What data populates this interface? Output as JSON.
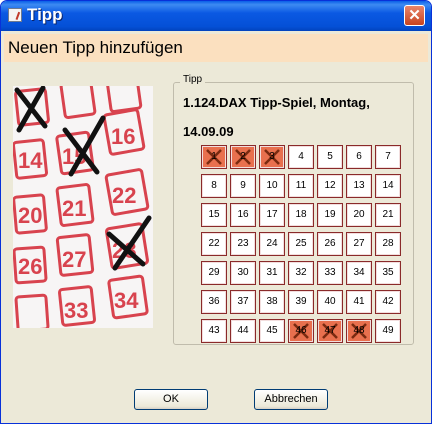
{
  "window": {
    "title": "Tipp",
    "close_symbol": "✕",
    "title_color": "#0550d6"
  },
  "header": {
    "text": "Neuen Tipp hinzufügen",
    "background": "#fbe0bf"
  },
  "tipp_group": {
    "legend": "Tipp",
    "game_title": "1.124.DAX Tipp-Spiel, Montag,",
    "game_date": "14.09.09"
  },
  "numbers": [
    [
      "1",
      "2",
      "3",
      "4",
      "5",
      "6",
      "7"
    ],
    [
      "8",
      "9",
      "10",
      "11",
      "12",
      "13",
      "14"
    ],
    [
      "15",
      "16",
      "17",
      "18",
      "19",
      "20",
      "21"
    ],
    [
      "22",
      "23",
      "24",
      "25",
      "26",
      "27",
      "28"
    ],
    [
      "29",
      "30",
      "31",
      "32",
      "33",
      "34",
      "35"
    ],
    [
      "36",
      "37",
      "38",
      "39",
      "40",
      "41",
      "42"
    ],
    [
      "43",
      "44",
      "45",
      "46",
      "47",
      "48",
      "49"
    ]
  ],
  "selected_numbers": [
    "1",
    "2",
    "3",
    "46",
    "47",
    "48"
  ],
  "selected_color": "#e8704e",
  "photo_numbers": [
    "14",
    "15",
    "16",
    "20",
    "21",
    "22",
    "26",
    "27",
    "28",
    "33",
    "34"
  ],
  "buttons": {
    "ok": "OK",
    "cancel": "Abbrechen"
  }
}
